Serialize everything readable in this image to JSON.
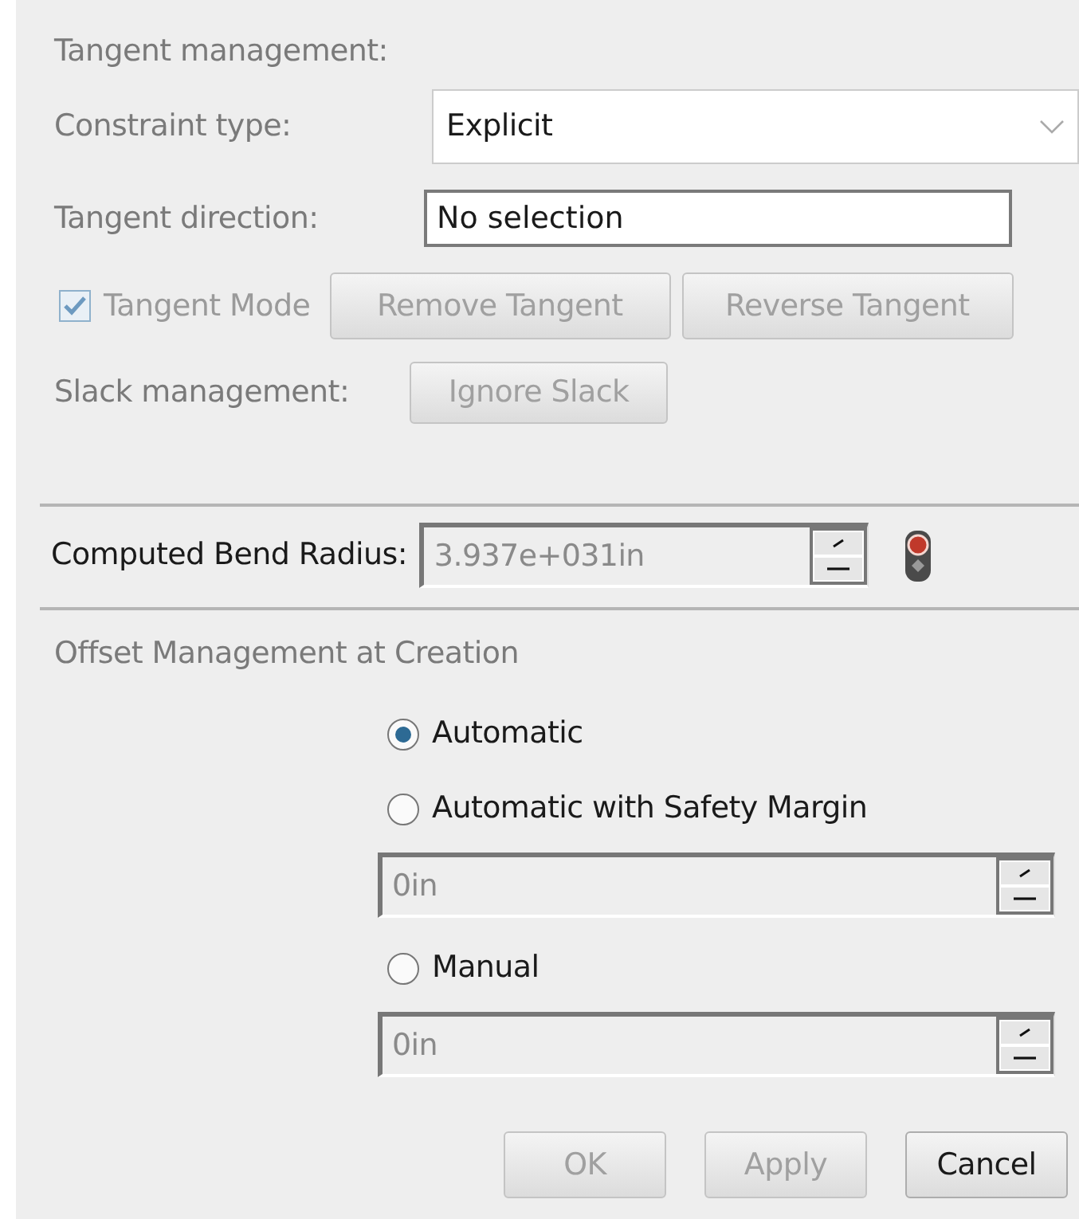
{
  "section_title": "Tangent management:",
  "constraint_type": {
    "label": "Constraint type:",
    "value": "Explicit"
  },
  "tangent_direction": {
    "label": "Tangent direction:",
    "value": "No selection"
  },
  "tangent_mode": {
    "label": "Tangent Mode",
    "checked": true,
    "disabled": true
  },
  "tangent_buttons": [
    {
      "label": "Remove Tangent",
      "disabled": true
    },
    {
      "label": "Reverse Tangent",
      "disabled": true
    }
  ],
  "slack": {
    "label": "Slack management:",
    "button": {
      "label": "Ignore Slack",
      "disabled": true
    }
  },
  "bend_radius": {
    "label": "Computed Bend Radius:",
    "value": "3.937e+031in",
    "disabled": true
  },
  "offset": {
    "title": "Offset Management at Creation",
    "options": [
      {
        "label": "Automatic",
        "selected": true
      },
      {
        "label": "Automatic with Safety Margin",
        "selected": false,
        "field": {
          "value": "0in",
          "disabled": true
        }
      },
      {
        "label": "Manual",
        "selected": false,
        "field": {
          "value": "0in",
          "disabled": true
        }
      }
    ]
  },
  "buttons": [
    {
      "label": "OK",
      "disabled": true
    },
    {
      "label": "Apply",
      "disabled": true
    },
    {
      "label": "Cancel",
      "disabled": false
    }
  ]
}
